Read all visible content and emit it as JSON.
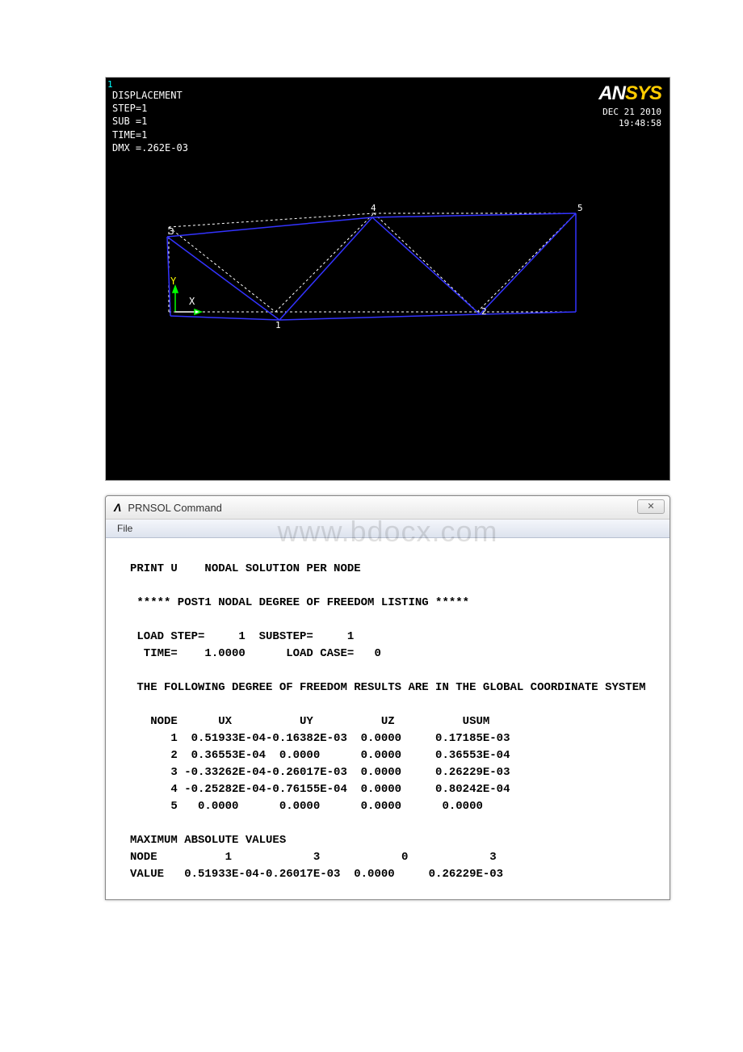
{
  "graphics": {
    "corner": "1",
    "title": "DISPLACEMENT",
    "step": "STEP=1",
    "sub": "SUB =1",
    "time": "TIME=1",
    "dmx": "DMX =.262E-03",
    "date": "DEC 21 2010",
    "clock": "19:48:58",
    "logo_an": "AN",
    "logo_sys": "SYS",
    "triad_y": "Y",
    "triad_x": "X",
    "nodes": {
      "n1": "1",
      "n2": "2",
      "n3": "3",
      "n4": "4",
      "n5": "5"
    }
  },
  "prnsol": {
    "window_title": "PRNSOL  Command",
    "menu_file": "File",
    "close_glyph": "✕",
    "watermark": "www.bdocx.com",
    "lines": {
      "l1": "PRINT U    NODAL SOLUTION PER NODE",
      "l2": " ***** POST1 NODAL DEGREE OF FREEDOM LISTING *****",
      "l3": " LOAD STEP=     1  SUBSTEP=     1",
      "l4": "  TIME=    1.0000      LOAD CASE=   0",
      "l5": " THE FOLLOWING DEGREE OF FREEDOM RESULTS ARE IN THE GLOBAL COORDINATE SYSTEM",
      "l6": "   NODE      UX          UY          UZ          USUM",
      "l7": "      1  0.51933E-04-0.16382E-03  0.0000     0.17185E-03",
      "l8": "      2  0.36553E-04  0.0000      0.0000     0.36553E-04",
      "l9": "      3 -0.33262E-04-0.26017E-03  0.0000     0.26229E-03",
      "l10": "      4 -0.25282E-04-0.76155E-04  0.0000     0.80242E-04",
      "l11": "      5   0.0000      0.0000      0.0000      0.0000",
      "l12": "MAXIMUM ABSOLUTE VALUES",
      "l13": "NODE          1            3            0            3",
      "l14": "VALUE   0.51933E-04-0.26017E-03  0.0000     0.26229E-03"
    }
  }
}
